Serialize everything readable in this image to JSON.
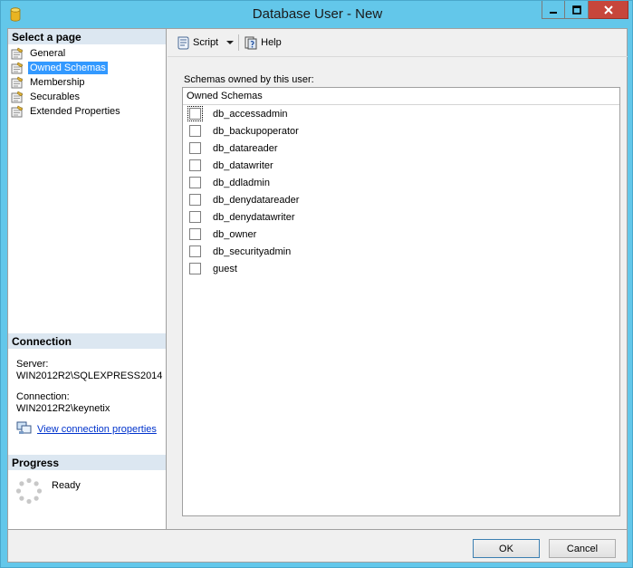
{
  "window": {
    "title": "Database User - New"
  },
  "left_pane": {
    "select_page_header": "Select a page",
    "pages": [
      {
        "label": "General",
        "selected": false
      },
      {
        "label": "Owned Schemas",
        "selected": true
      },
      {
        "label": "Membership",
        "selected": false
      },
      {
        "label": "Securables",
        "selected": false
      },
      {
        "label": "Extended Properties",
        "selected": false
      }
    ],
    "connection_header": "Connection",
    "server_label": "Server:",
    "server_value": "WIN2012R2\\SQLEXPRESS2014",
    "connection_label": "Connection:",
    "connection_value": "WIN2012R2\\keynetix",
    "view_connection_link": "View connection properties",
    "progress_header": "Progress",
    "progress_status": "Ready"
  },
  "toolbar": {
    "script_label": "Script",
    "help_label": "Help"
  },
  "main": {
    "caption": "Schemas owned by this user:",
    "column_header": "Owned Schemas",
    "schemas": [
      {
        "name": "db_accessadmin",
        "checked": false
      },
      {
        "name": "db_backupoperator",
        "checked": false
      },
      {
        "name": "db_datareader",
        "checked": false
      },
      {
        "name": "db_datawriter",
        "checked": false
      },
      {
        "name": "db_ddladmin",
        "checked": false
      },
      {
        "name": "db_denydatareader",
        "checked": false
      },
      {
        "name": "db_denydatawriter",
        "checked": false
      },
      {
        "name": "db_owner",
        "checked": false
      },
      {
        "name": "db_securityadmin",
        "checked": false
      },
      {
        "name": "guest",
        "checked": false
      }
    ]
  },
  "footer": {
    "ok_label": "OK",
    "cancel_label": "Cancel"
  },
  "colors": {
    "title_bar": "#63c7ea",
    "selection": "#3399ff",
    "section_header": "#dce7f1",
    "close_button": "#c7463b"
  }
}
